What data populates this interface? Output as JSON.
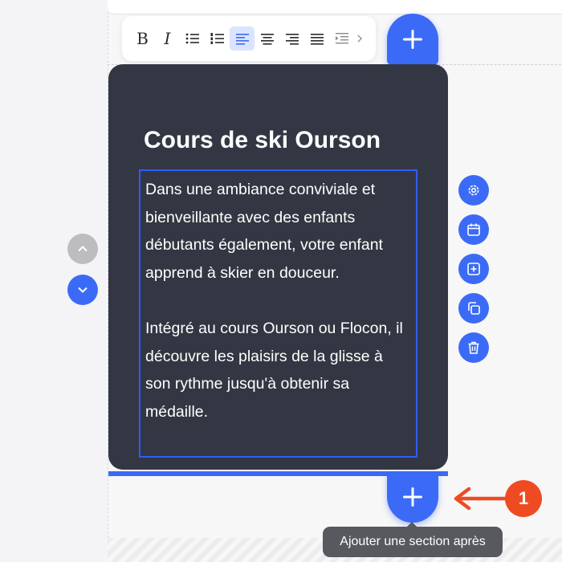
{
  "toolbar": {
    "items": [
      {
        "name": "bold",
        "icon": "bold-icon",
        "glyph": "B"
      },
      {
        "name": "italic",
        "icon": "italic-icon",
        "glyph": "I"
      },
      {
        "name": "bullet-list",
        "icon": "bullet-list-icon"
      },
      {
        "name": "numbered-list",
        "icon": "numbered-list-icon"
      },
      {
        "name": "align-left",
        "icon": "align-left-icon",
        "active": true
      },
      {
        "name": "align-center",
        "icon": "align-center-icon"
      },
      {
        "name": "align-right",
        "icon": "align-right-icon"
      },
      {
        "name": "justify",
        "icon": "justify-icon"
      },
      {
        "name": "indent",
        "icon": "indent-icon"
      },
      {
        "name": "more",
        "icon": "chevron-right-icon"
      }
    ]
  },
  "card": {
    "title": "Cours de ski Ourson",
    "paragraphs": [
      "Dans une ambiance conviviale et bienveillante avec des enfants débutants également, votre enfant apprend à skier en douceur.",
      "Intégré au cours Ourson ou Flocon, il découvre les plaisirs de la glisse à son rythme jusqu'à obtenir sa médaille."
    ]
  },
  "side_actions": [
    {
      "name": "settings",
      "icon": "gear-icon"
    },
    {
      "name": "schedule",
      "icon": "calendar-icon"
    },
    {
      "name": "add-block",
      "icon": "plus-square-icon"
    },
    {
      "name": "duplicate",
      "icon": "copy-icon"
    },
    {
      "name": "delete",
      "icon": "trash-icon"
    }
  ],
  "annotation": {
    "badge": "1"
  },
  "tooltip": {
    "text": "Ajouter une section après"
  },
  "colors": {
    "accent": "#3b6bf6",
    "card_bg": "#333743",
    "annotation": "#ef4b22",
    "tooltip_bg": "#58595e"
  }
}
